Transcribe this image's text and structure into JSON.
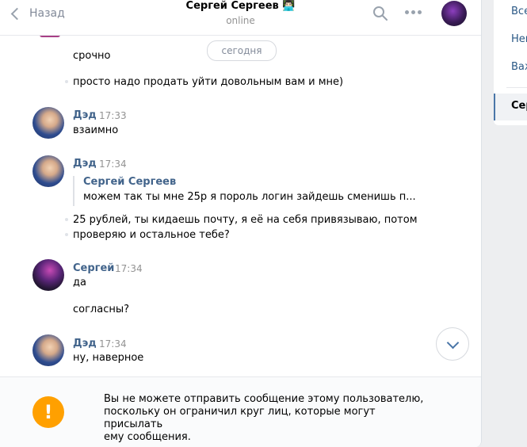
{
  "header": {
    "back_label": "Назад",
    "name": "Сергей Сергеев 👨🏻‍💻",
    "status": "online"
  },
  "date_pill": "сегодня",
  "messages": [
    {
      "text": "срочно"
    },
    {
      "text": "просто надо продать уйти довольным вам и мне)"
    },
    {
      "author": "Дэд",
      "time": "17:33",
      "text": "взаимно"
    },
    {
      "author": "Дэд",
      "time": "17:34",
      "forward": {
        "author": "Сергей Сергеев",
        "text": "можем так ты мне 25р я пороль логин зайдешь сменишь п..."
      },
      "text_lines": [
        "25 рублей, ты кидаешь почту, я её на себя привязываю, потом",
        "проверяю и остальное тебе?"
      ]
    },
    {
      "author": "Сергей",
      "time": "17:34",
      "text": "да",
      "text2": "согласны?"
    },
    {
      "author": "Дэд",
      "time": "17:34",
      "text": "ну, наверное"
    }
  ],
  "footer": {
    "warning_symbol": "!",
    "lines": [
      "Вы не можете отправить сообщение этому пользователю,",
      "поскольку он ограничил круг лиц, которые могут присылать",
      "ему сообщения."
    ]
  },
  "sidebar": {
    "items": [
      "Все",
      "Неп",
      "Важ"
    ],
    "active": "Сер"
  },
  "colors": {
    "link": "#42648b",
    "accent": "#4a76a8",
    "warning": "#ffa000"
  },
  "icons": {
    "search": "search-icon",
    "more": "more-icon",
    "back": "chevron-left-icon",
    "scroll": "chevron-down-icon"
  }
}
